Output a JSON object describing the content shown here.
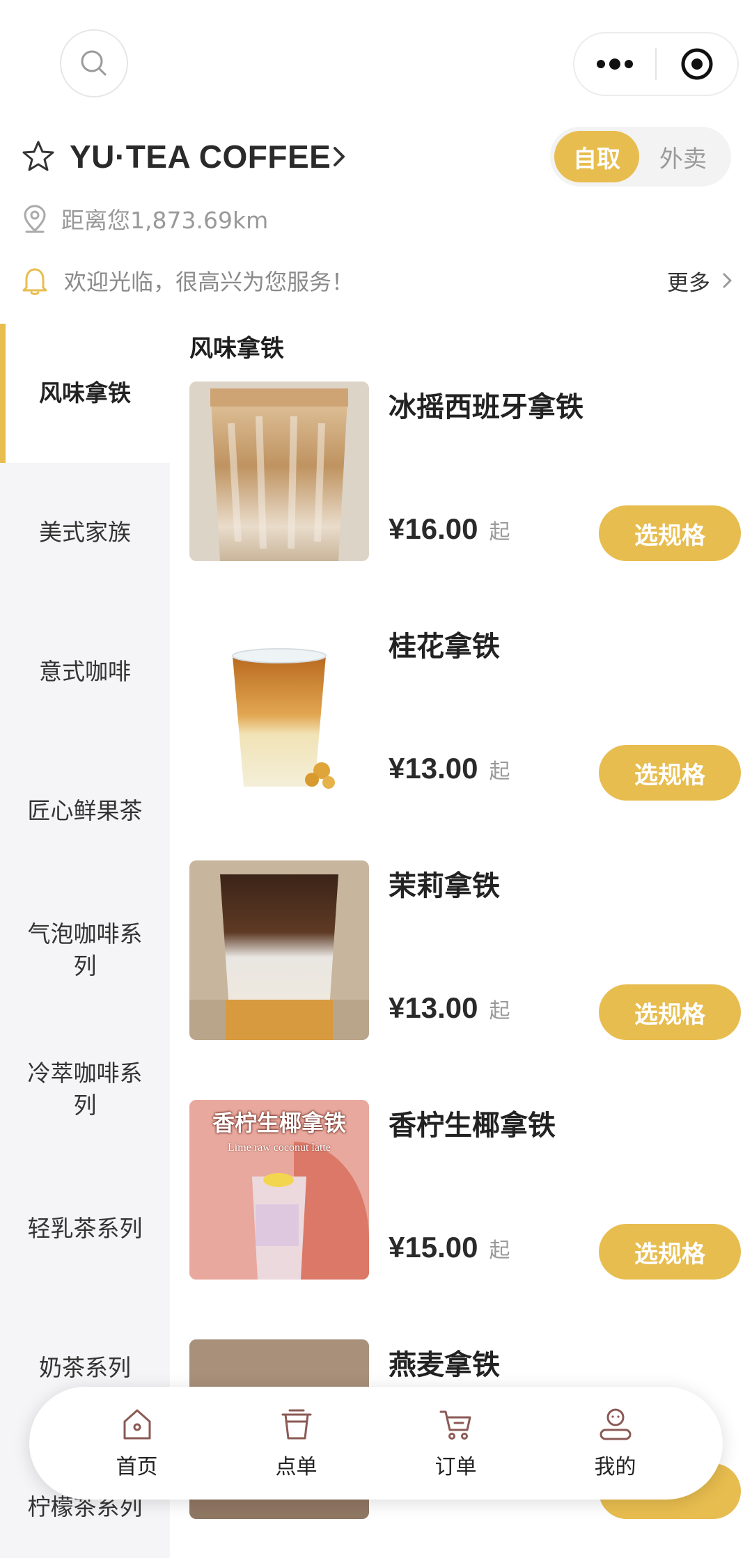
{
  "store": {
    "name": "YU·TEA COFFEE",
    "distance": "距离您1,873.69km",
    "notice": "欢迎光临，很高兴为您服务！",
    "more_label": "更多"
  },
  "mode_toggle": {
    "pickup": "自取",
    "delivery": "外卖"
  },
  "categories": [
    "风味拿铁",
    "美式家族",
    "意式咖啡",
    "匠心鲜果茶",
    "气泡咖啡系列",
    "冷萃咖啡系列",
    "轻乳茶系列",
    "奶茶系列",
    "柠檬茶系列"
  ],
  "section_title": "风味拿铁",
  "products": [
    {
      "name": "冰摇西班牙拿铁",
      "price": "¥16.00",
      "suffix": "起",
      "button": "选规格"
    },
    {
      "name": "桂花拿铁",
      "price": "¥13.00",
      "suffix": "起",
      "button": "选规格"
    },
    {
      "name": "茉莉拿铁",
      "price": "¥13.00",
      "suffix": "起",
      "button": "选规格"
    },
    {
      "name": "香柠生椰拿铁",
      "price": "¥15.00",
      "suffix": "起",
      "button": "选规格",
      "image_text_cn": "香柠生椰拿铁",
      "image_text_en": "Lime raw coconut latte"
    },
    {
      "name": "燕麦拿铁"
    }
  ],
  "tabbar": [
    {
      "label": "首页",
      "icon": "home-icon"
    },
    {
      "label": "点单",
      "icon": "cup-icon"
    },
    {
      "label": "订单",
      "icon": "cart-icon"
    },
    {
      "label": "我的",
      "icon": "user-icon"
    }
  ],
  "colors": {
    "accent": "#e8bd4f",
    "sidebar_bg": "#f5f5f7",
    "icon_brown": "#8b5a55"
  }
}
